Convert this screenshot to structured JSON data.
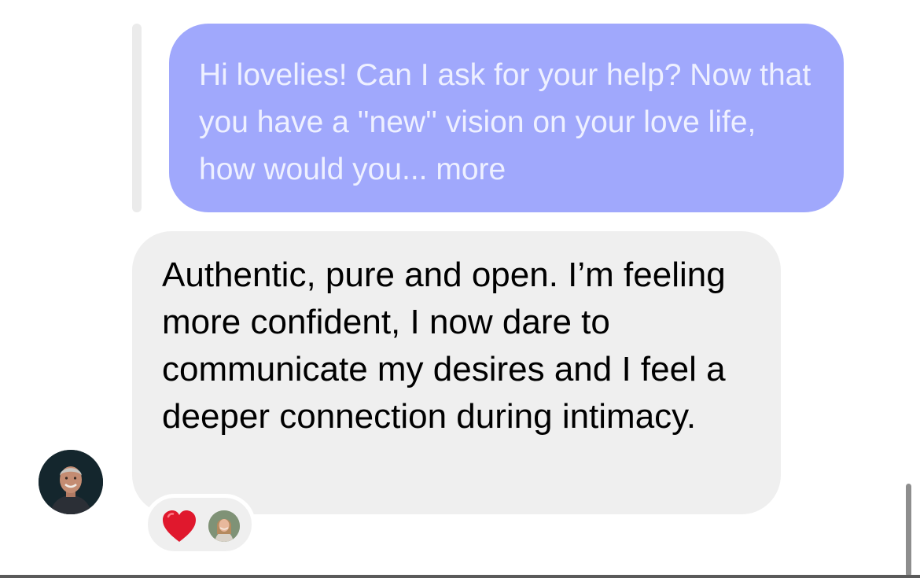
{
  "thread": {
    "quoted_message": {
      "text": "Hi lovelies! Can I ask for your help? Now that you have a ''new'' vision on your love life, how would you...",
      "more_label": "more"
    },
    "message": {
      "text": "Authentic, pure and open. I’m feeling more confident, I now dare to communicate my desires and I feel a deeper connection during intimacy."
    },
    "sender_avatar_icon": "person-avatar-icon",
    "reactions": {
      "emoji": "❤️",
      "emoji_icon": "red-heart-icon",
      "reactor_avatar_icon": "reactor-avatar-icon"
    }
  },
  "colors": {
    "quoted_bubble": "#a0a8fc",
    "quoted_text": "#eef0ff",
    "message_bubble": "#efefef",
    "heart": "#e0182d"
  }
}
